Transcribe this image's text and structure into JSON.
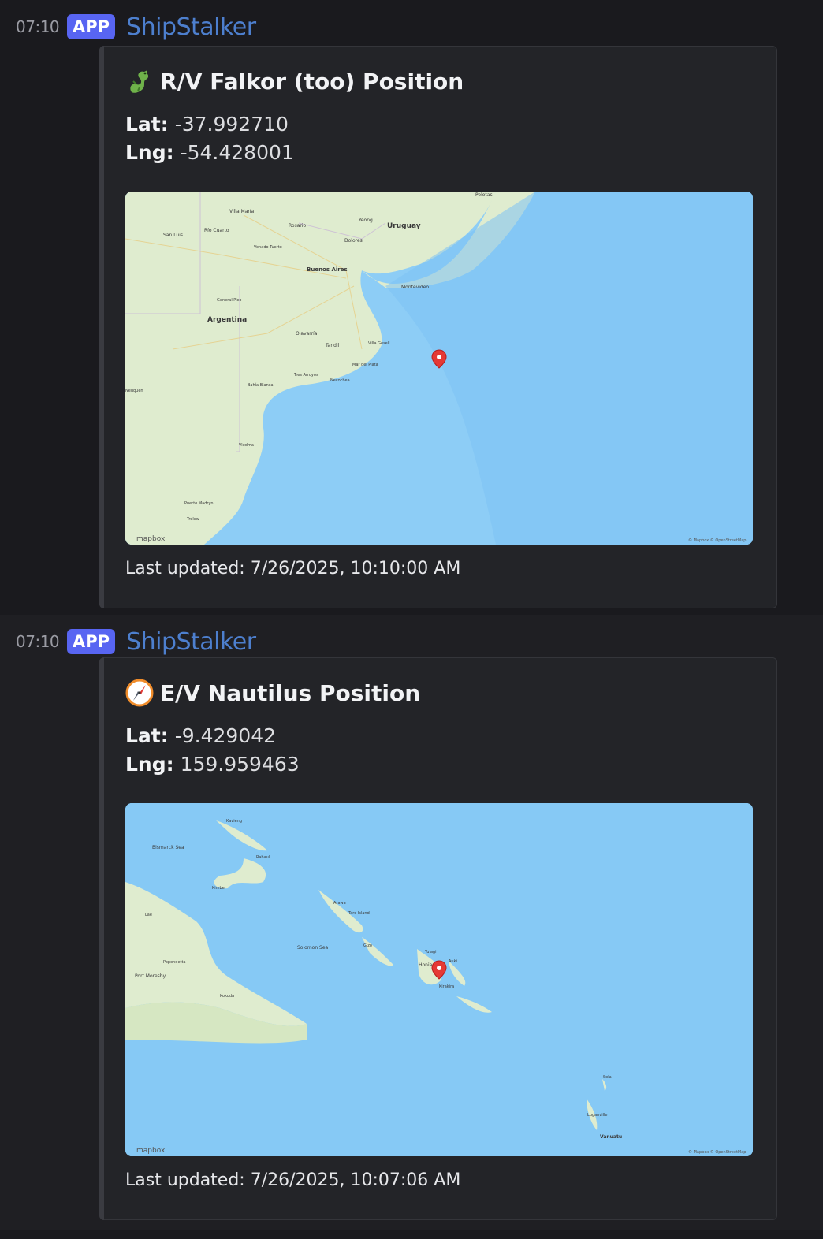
{
  "messages": [
    {
      "time": "07:10",
      "badge": "APP",
      "author": "ShipStalker",
      "title": "R/V Falkor (too) Position",
      "title_icon": "dragon-icon",
      "lat_label": "Lat:",
      "lat_value": "-37.992710",
      "lng_label": "Lng:",
      "lng_value": "-54.428001",
      "map_labels": [
        "Villa María",
        "Pelotas",
        "Yeong",
        "Uruguay",
        "Río Cuarto",
        "Rosario",
        "San Luis",
        "Venado Tuerto",
        "Dolores",
        "Buenos Aires",
        "Montevideo",
        "General Pico",
        "Argentina",
        "Olavarría",
        "Tandil",
        "Villa Gesell",
        "Mar del Plata",
        "Tres Arroyos",
        "Necochea",
        "Bahía Blanca",
        "Neuquén",
        "Viedma",
        "Puerto Madryn",
        "Trelew"
      ],
      "map_brand": "mapbox",
      "map_attribution": "© Mapbox © OpenStreetMap",
      "updated": "Last updated: 7/26/2025, 10:10:00 AM"
    },
    {
      "time": "07:10",
      "badge": "APP",
      "author": "ShipStalker",
      "title": "E/V Nautilus Position",
      "title_icon": "compass-icon",
      "lat_label": "Lat:",
      "lat_value": "-9.429042",
      "lng_label": "Lng:",
      "lng_value": "159.959463",
      "map_labels": [
        "Kavieng",
        "Bismarck Sea",
        "Rabaul",
        "Kimbe",
        "Lae",
        "Arawa",
        "Taro Island",
        "Gizo",
        "Solomon Sea",
        "Auki",
        "Popondetta",
        "Port Moresby",
        "Kokoda",
        "Tulagi",
        "Honiara",
        "Kirakira",
        "Sola",
        "Luganville",
        "Vanuatu"
      ],
      "map_brand": "mapbox",
      "map_attribution": "© Mapbox © OpenStreetMap",
      "updated": "Last updated: 7/26/2025, 10:07:06 AM"
    }
  ],
  "colors": {
    "badge": "#5865f2",
    "author": "#4d7fce",
    "pin": "#e53935",
    "ocean": "#7fc6f5",
    "land": "#dfeccf"
  }
}
